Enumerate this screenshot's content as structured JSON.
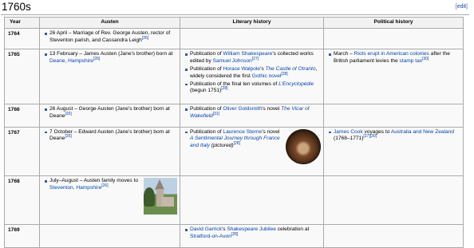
{
  "section": {
    "title": "1760s",
    "edit_open": "[",
    "edit_label": "edit",
    "edit_close": "]"
  },
  "headers": {
    "year": "Year",
    "austen": "Austen",
    "literary": "Literary history",
    "political": "Political history"
  },
  "rows": [
    {
      "year": "1764",
      "austen": [
        {
          "text": "26 April – Marriage of Rev. George Austen, rector of Steventon parish, and Cassandra Leigh",
          "ref": "[26]"
        }
      ]
    },
    {
      "year": "1765",
      "austen": [
        {
          "pre": "13 February – James Austen (Jane's brother) born at ",
          "link": "Deane, Hampshire",
          "ref": "[26]"
        }
      ],
      "literary": [
        {
          "pre": "Publication of ",
          "link": "William Shakespeare",
          "mid": "'s collected works edited by ",
          "link2": "Samuel Johnson",
          "ref": "[27]"
        },
        {
          "pre": "Publication of ",
          "link": "Horace Walpole",
          "mid": "'s ",
          "link2": "The Castle of Otranto",
          "post": ", widely considered the first ",
          "link3": "Gothic novel",
          "ref": "[28]"
        },
        {
          "pre": "Publication of the final ten volumes of ",
          "link": "L'Encyclopédie",
          "post": " (begun 1751)",
          "ref": "[28]"
        }
      ],
      "political": [
        {
          "pre": "March – ",
          "link": "Riots erupt in American colonies",
          "mid": " after the British parliament levies the ",
          "link2": "stamp tax",
          "ref": "[30]"
        }
      ]
    },
    {
      "year": "1766",
      "austen": [
        {
          "text": "26 August – George Austen (Jane's brother) born at Deane",
          "ref": "[26]"
        }
      ],
      "literary": [
        {
          "pre": "Publication of ",
          "link": "Oliver Goldsmith",
          "mid": "'s novel ",
          "link2": "The Vicar of Wakefield",
          "ref": "[31]"
        }
      ]
    },
    {
      "year": "1767",
      "austen": [
        {
          "text": "7 October – Edward Austen (Jane's brother) born at Deane",
          "ref": "[26]"
        }
      ],
      "literary": [
        {
          "pre": "Publication of ",
          "link": "Laurence Sterne",
          "mid": "'s novel ",
          "link2": "A Sentimental Journey through France and Italy",
          "post": " (pictured)",
          "ref": "[28]"
        }
      ],
      "political": [
        {
          "link": "James Cook",
          "mid": " voyages to ",
          "link2": "Australia and New Zealand",
          "post": " (1768–1771)",
          "ref": "[27]",
          "ref2": "[30]"
        }
      ]
    },
    {
      "year": "1768",
      "austen": [
        {
          "pre": "July–August – Austen family moves to ",
          "link": "Steventon, Hampshire",
          "ref": "[26]"
        }
      ]
    },
    {
      "year": "1769",
      "literary": [
        {
          "link": "David Garrick",
          "mid": "'s ",
          "link2": "Shakespeare Jubilee",
          "post": " celebration at ",
          "link3": "Stratford-on-Avon",
          "ref": "[28]"
        }
      ]
    }
  ]
}
